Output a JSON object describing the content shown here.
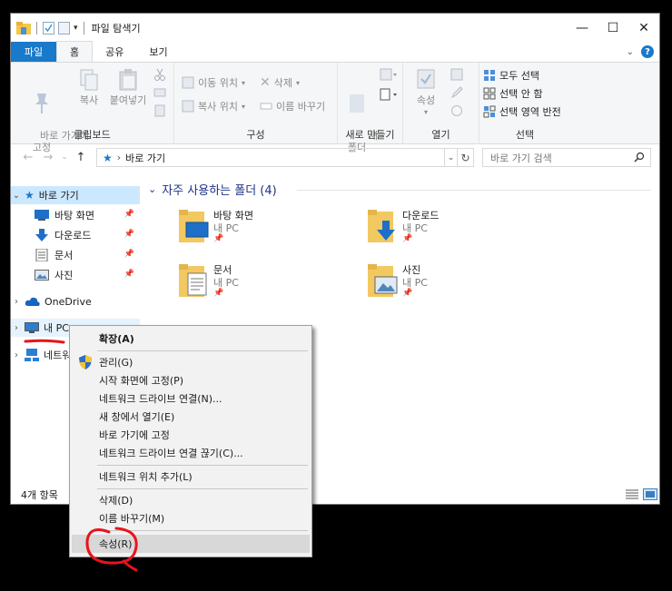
{
  "window": {
    "title": "파일 탐색기",
    "controls": {
      "minimize": "—",
      "maximize": "☐",
      "close": "✕"
    }
  },
  "ribbon_tabs": [
    "파일",
    "홈",
    "공유",
    "보기"
  ],
  "ribbon": {
    "clipboard": {
      "label": "클립보드",
      "pin": "바로 가기에\n고정",
      "copy": "복사",
      "paste": "붙여넣기"
    },
    "organize": {
      "label": "구성",
      "move_to": "이동 위치",
      "copy_to": "복사 위치",
      "delete": "삭제",
      "rename": "이름 바꾸기"
    },
    "new": {
      "label": "새로 만들기",
      "new_folder": "새\n폴더"
    },
    "open": {
      "label": "열기",
      "properties": "속성"
    },
    "select": {
      "label": "선택",
      "select_all": "모두 선택",
      "select_none": "선택 안 함",
      "invert": "선택 영역 반전"
    }
  },
  "address": {
    "path": "바로 가기",
    "search_placeholder": "바로 가기 검색"
  },
  "navpane": {
    "quick_access": "바로 가기",
    "desktop": "바탕 화면",
    "downloads": "다운로드",
    "documents": "문서",
    "pictures": "사진",
    "onedrive": "OneDrive",
    "this_pc": "내 PC",
    "network": "네트워크"
  },
  "content": {
    "section_title": "자주 사용하는 폴더 (4)",
    "folders": [
      {
        "name": "바탕 화면",
        "location": "내 PC"
      },
      {
        "name": "다운로드",
        "location": "내 PC"
      },
      {
        "name": "문서",
        "location": "내 PC"
      },
      {
        "name": "사진",
        "location": "내 PC"
      }
    ]
  },
  "status": {
    "count": "4개 항목"
  },
  "context_menu": {
    "expand": "확장(A)",
    "manage": "관리(G)",
    "pin_start": "시작 화면에 고정(P)",
    "map_drive": "네트워크 드라이브 연결(N)...",
    "open_new_window": "새 창에서 열기(E)",
    "pin_quick": "바로 가기에 고정",
    "disconnect_drive": "네트워크 드라이브 연결 끊기(C)...",
    "add_network_location": "네트워크 위치 추가(L)",
    "delete": "삭제(D)",
    "rename": "이름 바꾸기(M)",
    "properties": "속성(R)"
  },
  "colors": {
    "accent": "#1979ca",
    "selected": "#cce8ff",
    "annotation": "#e8141c"
  }
}
